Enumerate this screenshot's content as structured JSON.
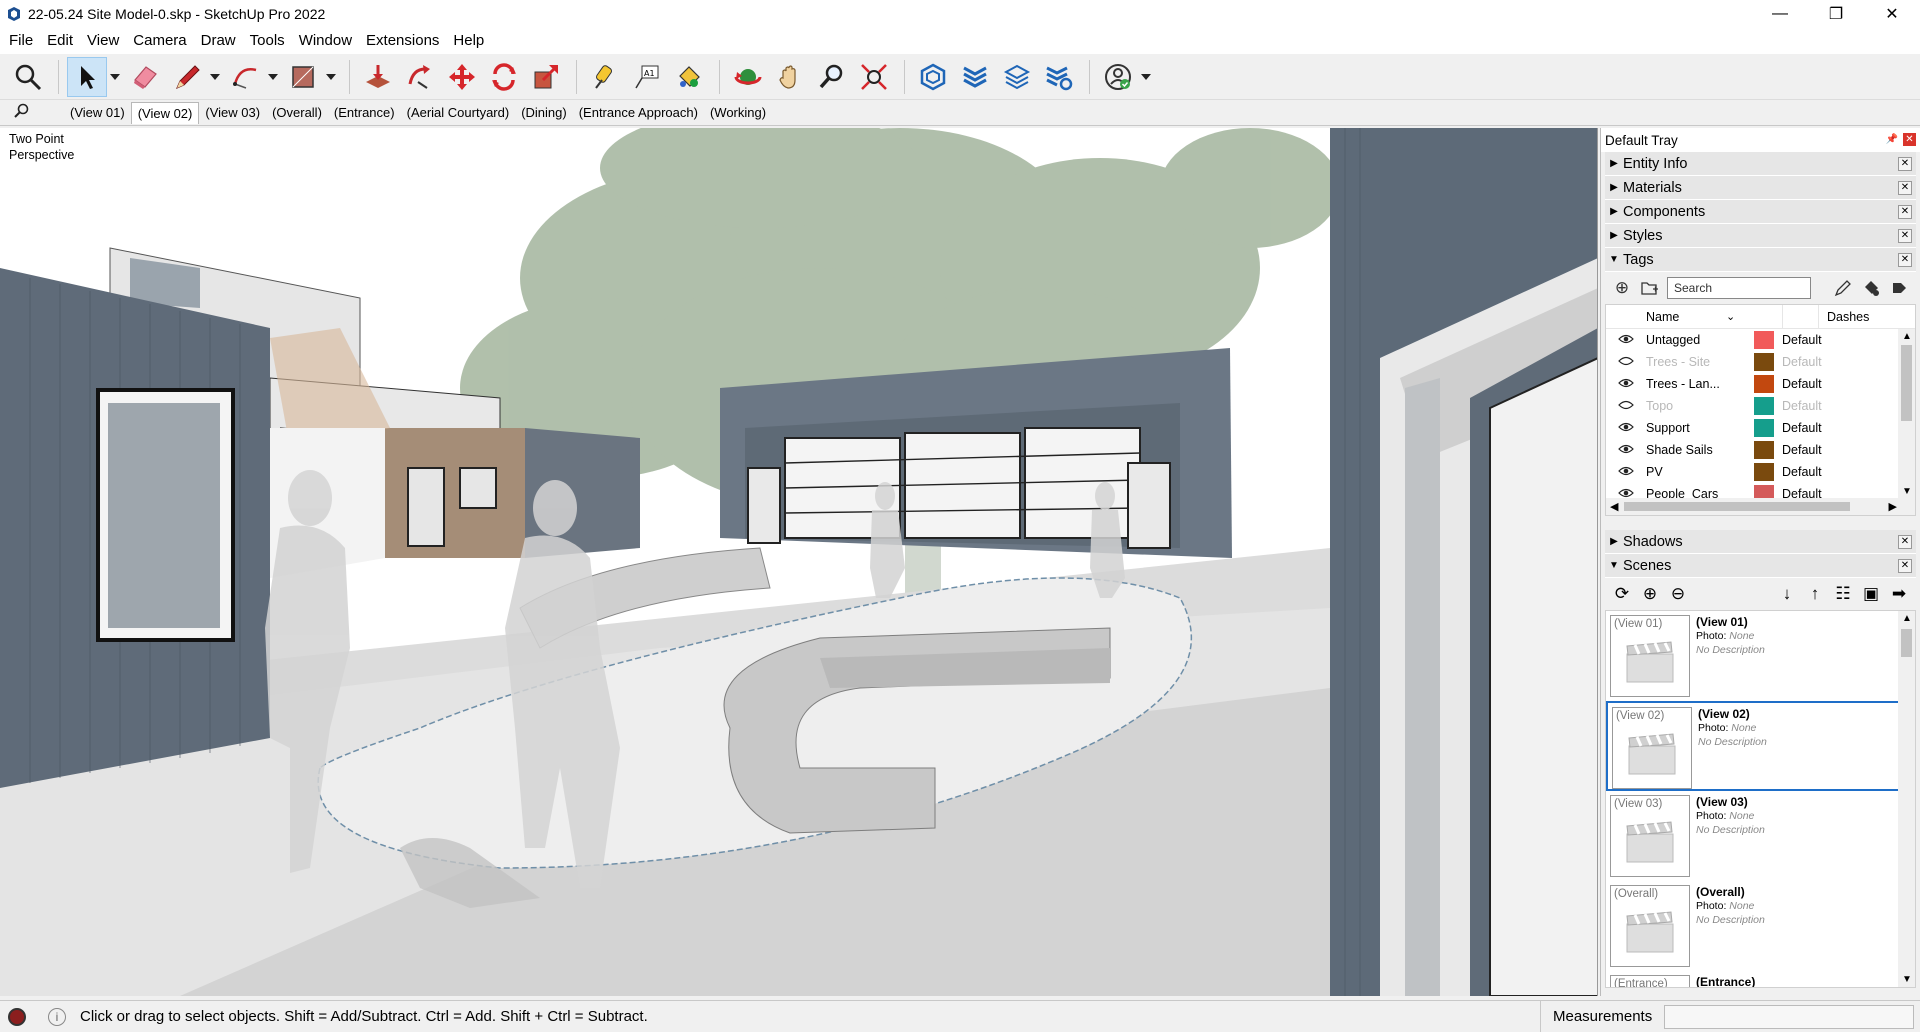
{
  "window": {
    "title": "22-05.24 Site Model-0.skp - SketchUp Pro 2022",
    "minimize": "—",
    "maximize": "❐",
    "close": "✕"
  },
  "menu": [
    "File",
    "Edit",
    "View",
    "Camera",
    "Draw",
    "Tools",
    "Window",
    "Extensions",
    "Help"
  ],
  "scene_tabs": [
    "(View 01)",
    "(View 02)",
    "(View 03)",
    "(Overall)",
    "(Entrance)",
    "(Aerial Courtyard)",
    "(Dining)",
    "(Entrance Approach)",
    "(Working)"
  ],
  "active_scene_tab": "(View 02)",
  "viewport": {
    "label_line1": "Two Point",
    "label_line2": "Perspective"
  },
  "tray": {
    "title": "Default Tray",
    "panels_top": [
      "Entity Info",
      "Materials",
      "Components",
      "Styles"
    ],
    "tags_panel": "Tags",
    "search_placeholder": "Search",
    "col_name": "Name",
    "col_dashes": "Dashes",
    "tags": [
      {
        "name": "Untagged",
        "visible": true,
        "color": "#f15a5a",
        "dashes": "Default"
      },
      {
        "name": "Trees - Site",
        "visible": false,
        "color": "#7a4a0e",
        "dashes": "Default"
      },
      {
        "name": "Trees - Lan...",
        "visible": true,
        "color": "#c2480f",
        "dashes": "Default"
      },
      {
        "name": "Topo",
        "visible": false,
        "color": "#159e8c",
        "dashes": "Default"
      },
      {
        "name": "Support",
        "visible": true,
        "color": "#159e8c",
        "dashes": "Default"
      },
      {
        "name": "Shade Sails",
        "visible": true,
        "color": "#7a4a0e",
        "dashes": "Default"
      },
      {
        "name": "PV",
        "visible": true,
        "color": "#7a4a0e",
        "dashes": "Default"
      },
      {
        "name": "People_Cars",
        "visible": true,
        "color": "#d45a5a",
        "dashes": "Default"
      }
    ],
    "shadows_panel": "Shadows",
    "scenes_panel": "Scenes",
    "scenes": [
      {
        "thumb": "(View 01)",
        "name": "(View 01)",
        "photo_label": "Photo:",
        "photo": "None",
        "desc": "No Description"
      },
      {
        "thumb": "(View 02)",
        "name": "(View 02)",
        "photo_label": "Photo:",
        "photo": "None",
        "desc": "No Description"
      },
      {
        "thumb": "(View 03)",
        "name": "(View 03)",
        "photo_label": "Photo:",
        "photo": "None",
        "desc": "No Description"
      },
      {
        "thumb": "(Overall)",
        "name": "(Overall)",
        "photo_label": "Photo:",
        "photo": "None",
        "desc": "No Description"
      },
      {
        "thumb": "(Entrance)",
        "name": "(Entrance)",
        "photo_label": "",
        "photo": "",
        "desc": ""
      }
    ]
  },
  "status": {
    "message": "Click or drag to select objects. Shift = Add/Subtract. Ctrl = Add. Shift + Ctrl = Subtract.",
    "measurements_label": "Measurements"
  },
  "colors": {
    "accent": "#1e6ec8",
    "wall": "#5d6a78",
    "tree": "#a7b8a0"
  }
}
